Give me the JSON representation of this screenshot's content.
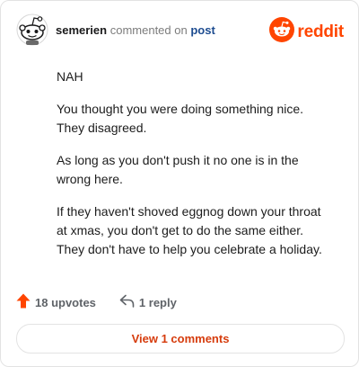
{
  "comment": {
    "username": "semerien",
    "action_text": "commented on",
    "target_link": "post",
    "brand": "reddit",
    "paragraphs": [
      "NAH",
      "You thought you were doing something nice. They disagreed.",
      "As long as you don't push it no one is in the wrong here.",
      "If they haven't shoved eggnog down your throat at xmas, you don't get to do the same either. They don't have to help you celebrate a holiday."
    ]
  },
  "actions": {
    "upvotes": "18 upvotes",
    "replies": "1 reply"
  },
  "view_button": "View 1 comments",
  "colors": {
    "brand": "#ff4500",
    "link": "#1d4c90",
    "button_text": "#d63c0d"
  },
  "icons": [
    "snoo-avatar-icon",
    "reddit-logo-icon",
    "upvote-arrow-icon",
    "reply-arrow-icon"
  ]
}
